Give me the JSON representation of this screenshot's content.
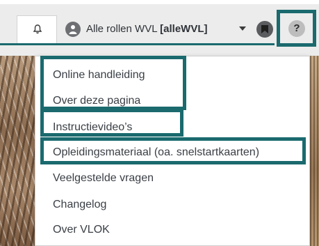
{
  "header": {
    "role_label_prefix": "Alle rollen WVL",
    "role_label_code": "[alleWVL]",
    "help_label": "?"
  },
  "icons": {
    "notification": "bell-icon",
    "user": "user-icon",
    "dropdown": "caret-down-icon",
    "bookmark": "bookmark-icon",
    "help": "question-icon"
  },
  "help_menu": {
    "items": [
      {
        "label": "Online handleiding"
      },
      {
        "label": "Over deze pagina"
      },
      {
        "label": "Instructievideo’s"
      },
      {
        "label": "Opleidingsmateriaal (oa. snelstartkaarten)"
      },
      {
        "label": "Veelgestelde vragen"
      },
      {
        "label": "Changelog"
      },
      {
        "label": "Over VLOK"
      }
    ]
  },
  "colors": {
    "highlight": "#1a6a6e",
    "topbar": "#ececec",
    "text": "#3a3f45"
  }
}
